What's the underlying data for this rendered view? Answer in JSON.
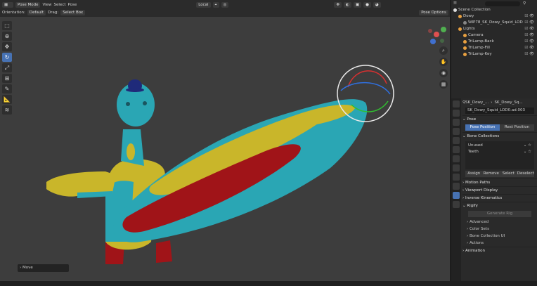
{
  "header": {
    "mode": "Pose Mode",
    "menus": [
      "View",
      "Select",
      "Pose"
    ],
    "transform_orientation": "Local",
    "orientation_label": "Orientation:",
    "orientation_value": "Default",
    "drag_label": "Drag:",
    "drag_value": "Select Box",
    "pose_options": "Pose Options"
  },
  "tools": [
    "select",
    "cursor",
    "move",
    "rotate",
    "scale",
    "transform",
    "annotate",
    "measure",
    "relax"
  ],
  "operator_panel": "Move",
  "outliner": {
    "search_placeholder": "",
    "root": "Scene Collection",
    "rows": [
      {
        "label": "Dowy",
        "indent": 1,
        "color": "#e8a040"
      },
      {
        "label": "WIP78_SK_Dowy_Squid_LOD",
        "indent": 2,
        "color": "#888888"
      },
      {
        "label": "Lights",
        "indent": 1,
        "color": "#e8a040"
      },
      {
        "label": "Camera",
        "indent": 2,
        "color": "#e8a040"
      },
      {
        "label": "TriLamp-Back",
        "indent": 2,
        "color": "#e8a040"
      },
      {
        "label": "TriLamp-Fill",
        "indent": 2,
        "color": "#e8a040"
      },
      {
        "label": "TriLamp-Key",
        "indent": 2,
        "color": "#e8a040"
      }
    ]
  },
  "properties": {
    "breadcrumb": [
      "SK_Dowy_...",
      "SK_Dowy_Sq..."
    ],
    "armature_name": "SK_Dowy_Squid_LOD0.ad.003",
    "pose_panel": "Pose",
    "pose_position": "Pose Position",
    "rest_position": "Rest Position",
    "bone_collections_panel": "Bone Collections",
    "bone_collections": [
      "Unused",
      "Teeth"
    ],
    "buttons": [
      "Assign",
      "Remove",
      "Select",
      "Deselect"
    ],
    "panels": [
      "Motion Paths",
      "Viewport Display",
      "Inverse Kinematics",
      "Rigify"
    ],
    "rigify_button": "Generate Rig",
    "rigify_subpanels": [
      "Advanced",
      "Color Sets",
      "Bone Collection UI",
      "Actions"
    ],
    "animation_panel": "Animation"
  },
  "colors": {
    "accent": "#4772b3",
    "viewport_bg": "#3d3d3d",
    "paint_cyan": "#2aa6b4",
    "paint_yellow": "#c9b62a",
    "paint_red": "#a01418"
  }
}
